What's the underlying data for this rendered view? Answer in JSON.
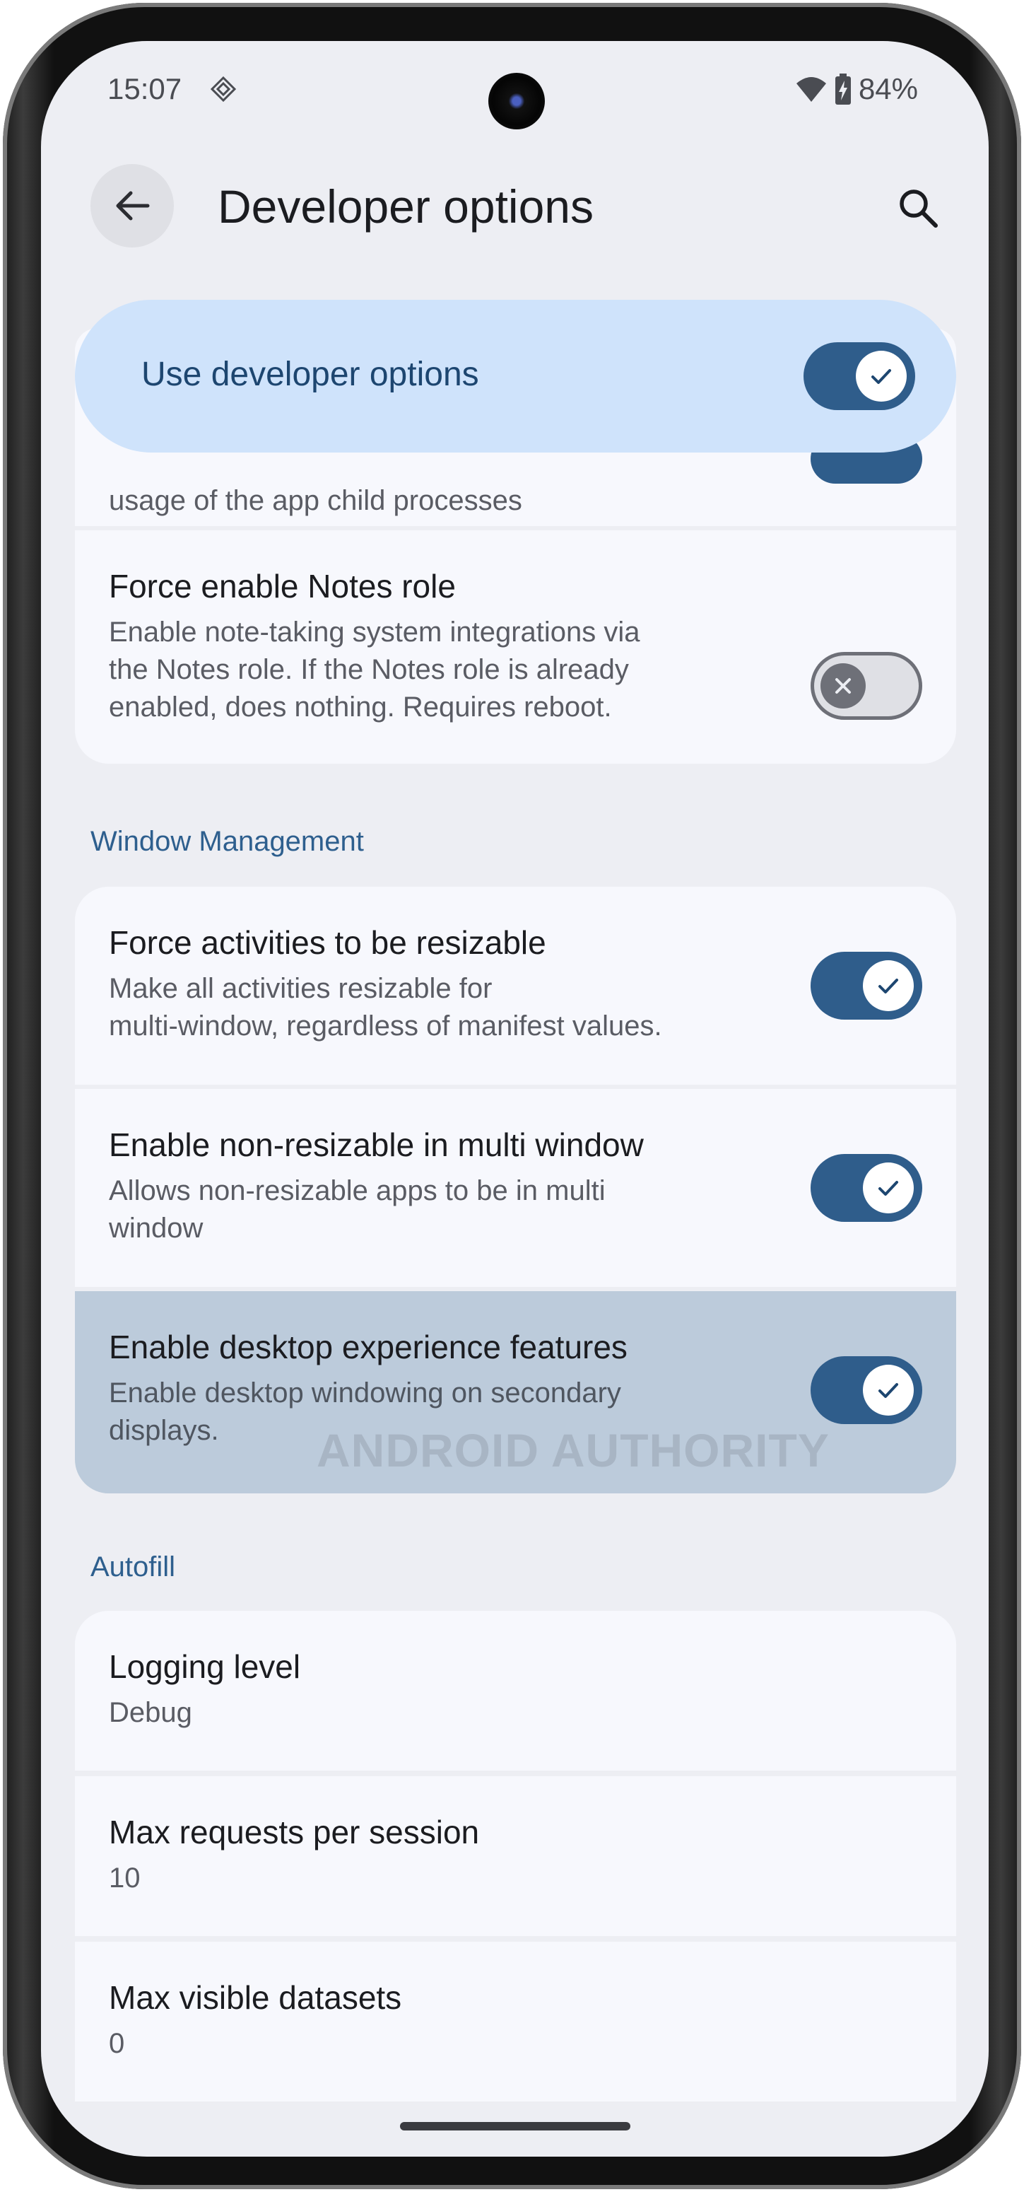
{
  "status_bar": {
    "time": "15:07",
    "battery": "84%"
  },
  "app_bar": {
    "title": "Developer options"
  },
  "banner": {
    "label": "Use developer options",
    "enabled": true
  },
  "partial_item": {
    "subtitle": "usage of the app child processes"
  },
  "items_top": [
    {
      "title": "Force enable Notes role",
      "subtitle_lines": [
        "Enable note-taking system integrations via",
        "the Notes role. If the Notes role is already",
        "enabled, does nothing. Requires reboot."
      ],
      "enabled": false
    }
  ],
  "sections": {
    "window_management": {
      "title": "Window Management",
      "items": [
        {
          "title": "Force activities to be resizable",
          "subtitle_lines": [
            "Make all activities resizable for",
            "multi-window, regardless of manifest values."
          ],
          "enabled": true
        },
        {
          "title": "Enable non-resizable in multi window",
          "subtitle_lines": [
            "Allows non-resizable apps to be in multi",
            "window"
          ],
          "enabled": true
        },
        {
          "title": "Enable desktop experience features",
          "subtitle_lines": [
            "Enable desktop windowing on secondary",
            "displays."
          ],
          "enabled": true
        }
      ]
    },
    "autofill": {
      "title": "Autofill",
      "items": [
        {
          "title": "Logging level",
          "value": "Debug"
        },
        {
          "title": "Max requests per session",
          "value": "10"
        },
        {
          "title": "Max visible datasets",
          "value": "0"
        }
      ]
    }
  },
  "watermark": "ANDROID AUTHORITY",
  "colors": {
    "accent": "#2f5d8b",
    "banner": "#cfe3fb",
    "background": "#edeef3",
    "card": "#f7f8fd",
    "pressed": "#bccbdb"
  }
}
